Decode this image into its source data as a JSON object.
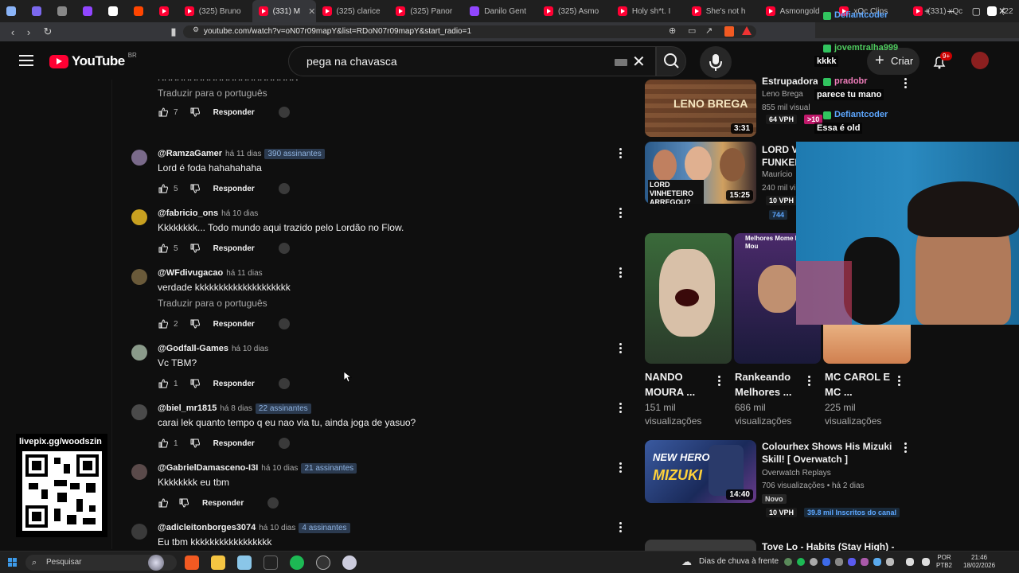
{
  "browser": {
    "tabs": [
      {
        "label": "",
        "color": "#8ab4f8"
      },
      {
        "label": "",
        "color": "#7b68ee"
      },
      {
        "label": "",
        "color": "#888888"
      },
      {
        "label": "",
        "color": "#9146ff"
      },
      {
        "label": "",
        "color": "#ffffff"
      },
      {
        "label": "",
        "color": "#ff4500"
      },
      {
        "label": "",
        "color": "#ff0033"
      },
      {
        "label": "(325) Bruno",
        "color": "#ff0033"
      },
      {
        "label": "(331) M",
        "color": "#ff0033",
        "active": true
      },
      {
        "label": "(325) clarice",
        "color": "#ff0033"
      },
      {
        "label": "(325) Panor",
        "color": "#ff0033"
      },
      {
        "label": "Danilo Gent",
        "color": "#9146ff"
      },
      {
        "label": "(325) Asmo",
        "color": "#ff0033"
      },
      {
        "label": "Holy sh*t. I",
        "color": "#ff0033"
      },
      {
        "label": "She's not h",
        "color": "#ff0033"
      },
      {
        "label": "Asmongold",
        "color": "#ff0033"
      },
      {
        "label": "xQc Clips",
        "color": "#ff0033"
      },
      {
        "label": "(331) xQc",
        "color": "#ff0033"
      },
      {
        "label": "(22",
        "color": "#ffffff"
      }
    ],
    "url": "youtube.com/watch?v=oN07r09mapY&list=RDoN07r09mapY&start_radio=1"
  },
  "youtube": {
    "logo_text": "YouTube",
    "region": "BR",
    "search_value": "pega na chavasca",
    "create_label": "Criar",
    "notif_badge": "9+"
  },
  "comments": [
    {
      "user": "",
      "date": "",
      "sub": "",
      "text": "KKKKKKKKKKKKKKKKKKKKKK",
      "translate": "Traduzir para o português",
      "likes": "7",
      "avatar": "#555555"
    },
    {
      "user": "@RamzaGamer",
      "date": "há 11 dias",
      "sub": "390 assinantes",
      "text": "Lord é foda hahahahaha",
      "translate": "",
      "likes": "5",
      "avatar": "#7a6a8a"
    },
    {
      "user": "@fabricio_ons",
      "date": "há 10 dias",
      "sub": "",
      "text": "Kkkkkkkk... Todo mundo aqui trazido pelo Lordão no Flow.",
      "translate": "",
      "likes": "5",
      "avatar": "#c8a020"
    },
    {
      "user": "@WFdivugacao",
      "date": "há 11 dias",
      "sub": "",
      "text": "verdade kkkkkkkkkkkkkkkkkkkk",
      "translate": "Traduzir para o português",
      "likes": "2",
      "avatar": "#6a5a3a"
    },
    {
      "user": "@Godfall-Games",
      "date": "há 10 dias",
      "sub": "",
      "text": "Vc TBM?",
      "translate": "",
      "likes": "1",
      "avatar": "#8a9a8a"
    },
    {
      "user": "@biel_mr1815",
      "date": "há 8 dias",
      "sub": "22 assinantes",
      "text": "carai lek quanto tempo q eu nao via tu, ainda joga de yasuo?",
      "translate": "",
      "likes": "1",
      "avatar": "#4a4a4a"
    },
    {
      "user": "@GabrielDamasceno-I3I",
      "date": "há 10 dias",
      "sub": "21 assinantes",
      "text": "Kkkkkkkk eu tbm",
      "translate": "",
      "likes": "",
      "avatar": "#5a4a4a"
    },
    {
      "user": "@adicleitonborges3074",
      "date": "há 10 dias",
      "sub": "4 assinantes",
      "text": "Eu tbm kkkkkkkkkkkkkkkkk",
      "translate": "",
      "likes": "",
      "avatar": "#3a3a3a"
    }
  ],
  "comment_labels": {
    "reply": "Responder"
  },
  "sidebar": {
    "videos": [
      {
        "title": "Estrupadora",
        "channel": "Leno Brega",
        "meta": "855 mil visualizações • há 2 anos",
        "duration": "3:31",
        "chip1": "64 VPH",
        "chip2": ">10"
      },
      {
        "title": "LORD VI\nFUNKEIR",
        "channel": "Maurício",
        "meta": "240 mil vi",
        "duration": "15:25",
        "chip1": "10 VPH",
        "chip2": "744"
      },
      {
        "title": "Colourhex Shows His Mizuki Skill! [ Overwatch ]",
        "channel": "Overwatch Replays",
        "meta": "706 visualizações • há 2 dias",
        "duration": "14:40",
        "chip1": "10 VPH",
        "chip2": "39.8 mil Inscritos do canal",
        "badge": "Novo"
      },
      {
        "title": "Tove Lo - Habits (Stay High) -",
        "channel": "",
        "meta": "",
        "duration": "",
        "chip1": "",
        "chip2": ""
      }
    ],
    "shorts": [
      {
        "title": "NANDO MOURA ...",
        "views": "151 mil visualizações"
      },
      {
        "title": "Rankeando Melhores ...",
        "views": "686 mil visualizações"
      },
      {
        "title": "MC CAROL E MC ...",
        "views": "225 mil visualizações"
      }
    ],
    "thumb_texts": {
      "leno": "LENO BREGA",
      "lord": "LORD VINHETEIRO ARREGOU?",
      "mizuki1": "NEW HERO",
      "mizuki2": "MIZUKI",
      "melhores": "Melhores Mome Nando Mou"
    }
  },
  "chat": [
    {
      "name": "Defiantcoder",
      "msg": "",
      "color": "blue"
    },
    {
      "name": "jovemtralha999",
      "msg": "kkkk",
      "color": "green"
    },
    {
      "name": "pradobr",
      "msg": "parece tu mano",
      "color": "pink"
    },
    {
      "name": "Defiantcoder",
      "msg": "Essa é old",
      "color": "blue"
    }
  ],
  "overlay": {
    "qr_title": "livepix.gg/woodszin"
  },
  "taskbar": {
    "search": "Pesquisar",
    "weather": "Dias de chuva à frente",
    "lang1": "POR",
    "lang2": "PTB2",
    "time": "21:46",
    "date": "18/02/2026"
  }
}
